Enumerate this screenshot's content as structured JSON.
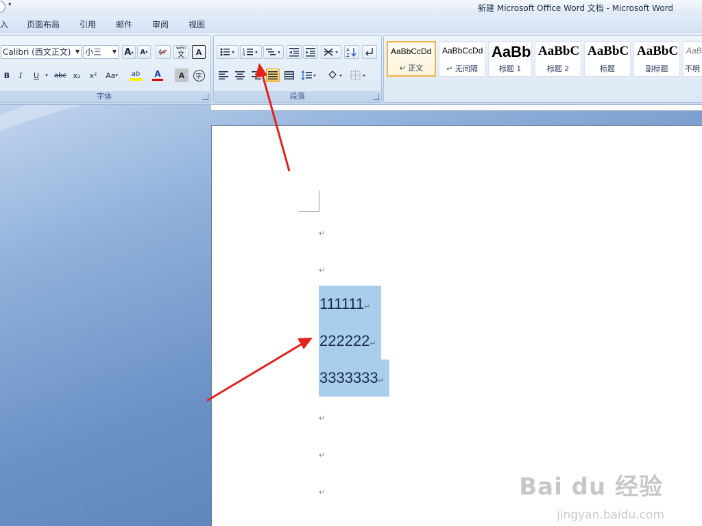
{
  "window": {
    "title": "新建 Microsoft Office Word 文档 - Microsoft Word"
  },
  "menu": {
    "tabs": [
      "入",
      "页面布局",
      "引用",
      "邮件",
      "审阅",
      "视图"
    ]
  },
  "font_group": {
    "label": "字体",
    "font_name": "Calibri (西文正文)",
    "font_size": "小三",
    "grow_label": "A",
    "shrink_label": "A",
    "phonetic_label": "wén",
    "phonetic_char": "文",
    "border_char": "A",
    "bold": "B",
    "italic": "I",
    "underline": "U",
    "strike": "abc",
    "subscript": "x₂",
    "superscript": "x²",
    "change_case": "Aa",
    "highlight": "ab",
    "font_color": "A",
    "shading_char": "A",
    "enclose_char": "字"
  },
  "paragraph_group": {
    "label": "段落"
  },
  "styles": [
    {
      "sample": "AaBbCcDd",
      "name": "↵ 正文",
      "selected": true
    },
    {
      "sample": "AaBbCcDd",
      "name": "↵ 无间隔",
      "selected": false
    },
    {
      "sample": "AaBb",
      "name": "标题 1",
      "selected": false
    },
    {
      "sample": "AaBbC",
      "name": "标题 2",
      "selected": false
    },
    {
      "sample": "AaBbC",
      "name": "标题",
      "selected": false
    },
    {
      "sample": "AaBbC",
      "name": "副标题",
      "selected": false
    },
    {
      "sample": "AaBbCcD",
      "name": "不明",
      "selected": false
    }
  ],
  "document": {
    "lines": [
      "111111",
      "222222",
      "3333333"
    ],
    "paragraph_mark": "↵"
  },
  "watermark": {
    "brand": "Bai du 经验",
    "url": "jingyan.baidu.com"
  },
  "colors": {
    "annotation_arrow": "#e0211c",
    "selection": "#a9cdec",
    "highlight_yellow": "#ffee00",
    "font_color_red": "#e00000",
    "active_button": "#ffc54a"
  }
}
